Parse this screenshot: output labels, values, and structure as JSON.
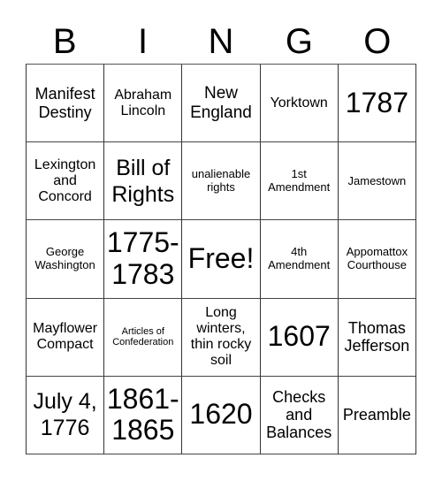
{
  "header": {
    "letters": [
      "B",
      "I",
      "N",
      "G",
      "O"
    ]
  },
  "cells": [
    "Manifest Destiny",
    "Abraham Lincoln",
    "New England",
    "Yorktown",
    "1787",
    "Lexington and Concord",
    "Bill of Rights",
    "unalienable rights",
    "1st Amendment",
    "Jamestown",
    "George Washington",
    "1775-1783",
    "Free!",
    "4th Amendment",
    "Appomattox Courthouse",
    "Mayflower Compact",
    "Articles of Confederation",
    "Long winters, thin rocky soil",
    "1607",
    "Thomas Jefferson",
    "July 4, 1776",
    "1861-1865",
    "1620",
    "Checks and Balances",
    "Preamble"
  ]
}
